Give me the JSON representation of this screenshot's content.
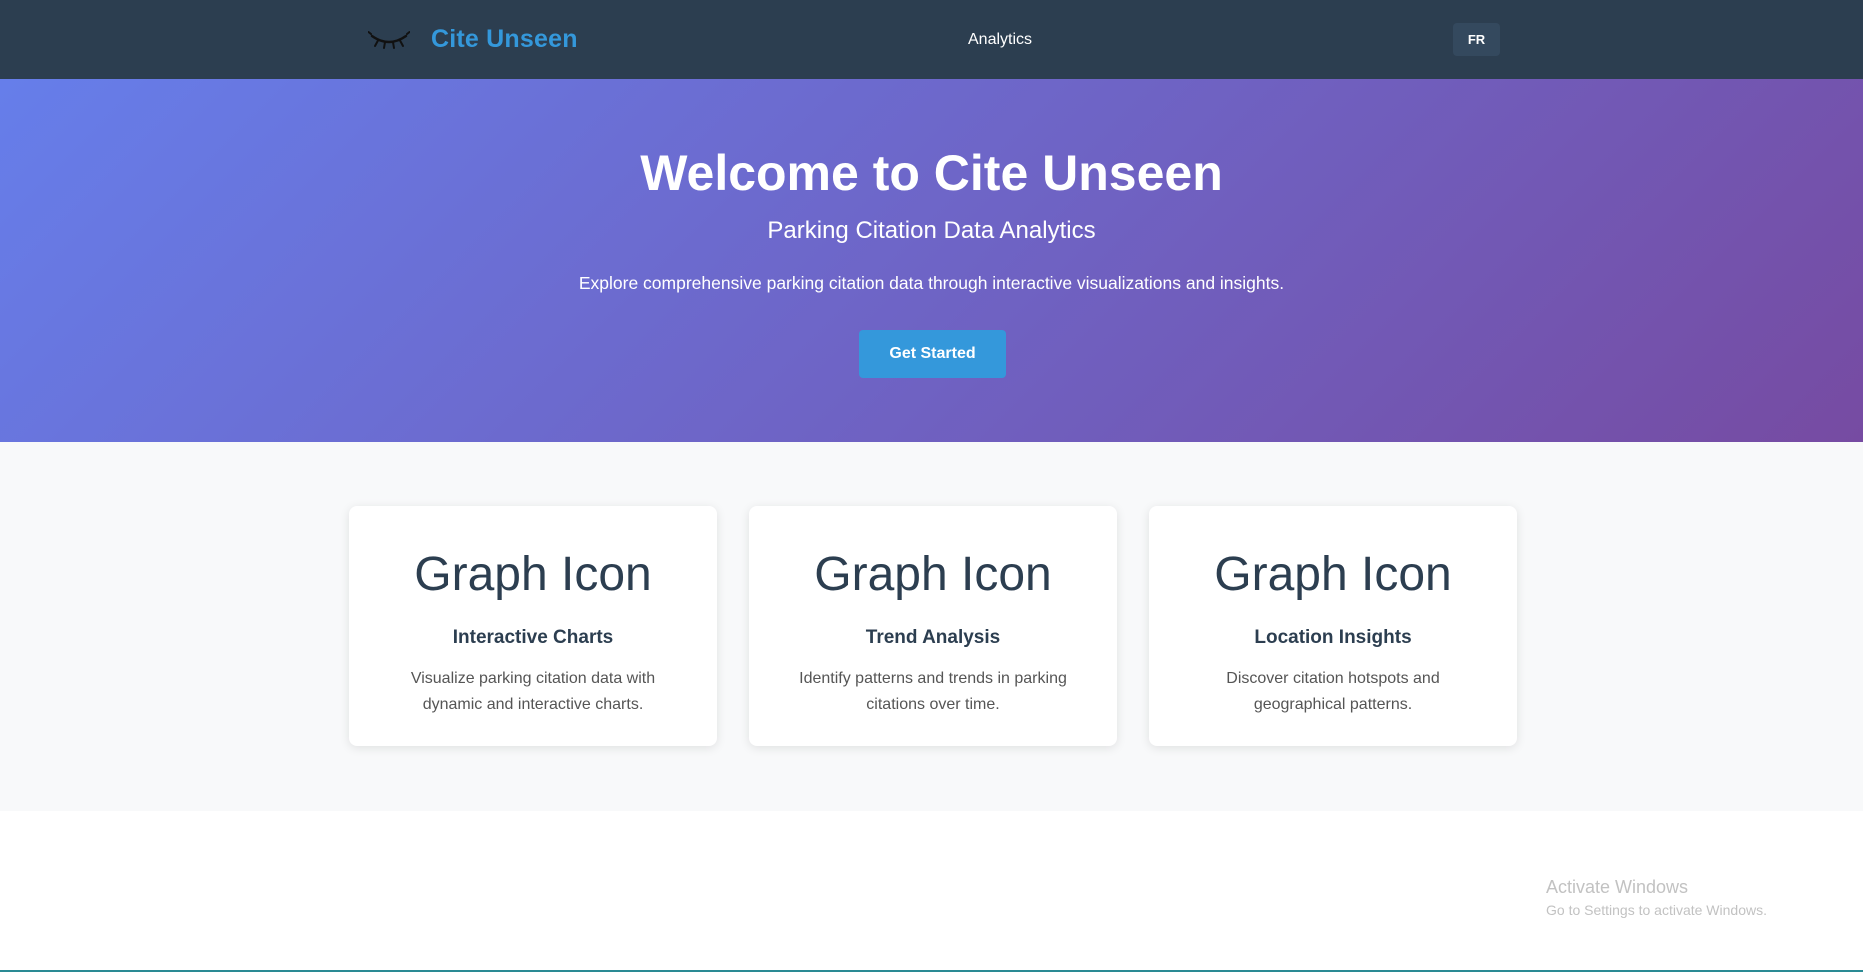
{
  "navbar": {
    "brand": "Cite Unseen",
    "links": [
      {
        "label": "Analytics"
      }
    ],
    "language_button": "FR"
  },
  "hero": {
    "title": "Welcome to Cite Unseen",
    "subtitle": "Parking Citation Data Analytics",
    "description": "Explore comprehensive parking citation data through interactive visualizations and insights.",
    "cta_label": "Get Started"
  },
  "features": [
    {
      "icon_text": "Graph Icon",
      "title": "Interactive Charts",
      "description": "Visualize parking citation data with dynamic and interactive charts."
    },
    {
      "icon_text": "Graph Icon",
      "title": "Trend Analysis",
      "description": "Identify patterns and trends in parking citations over time."
    },
    {
      "icon_text": "Graph Icon",
      "title": "Location Insights",
      "description": "Discover citation hotspots and geographical patterns."
    }
  ],
  "os_watermark": {
    "title": "Activate Windows",
    "subtitle": "Go to Settings to activate Windows."
  },
  "colors": {
    "navbar_bg": "#2c3e50",
    "brand": "#3498db",
    "hero_gradient_start": "#667eea",
    "hero_gradient_end": "#764ba2",
    "cta_bg": "#3498db",
    "features_bg": "#f8f9fa"
  },
  "icons": {
    "logo": "closed-eye-icon"
  }
}
